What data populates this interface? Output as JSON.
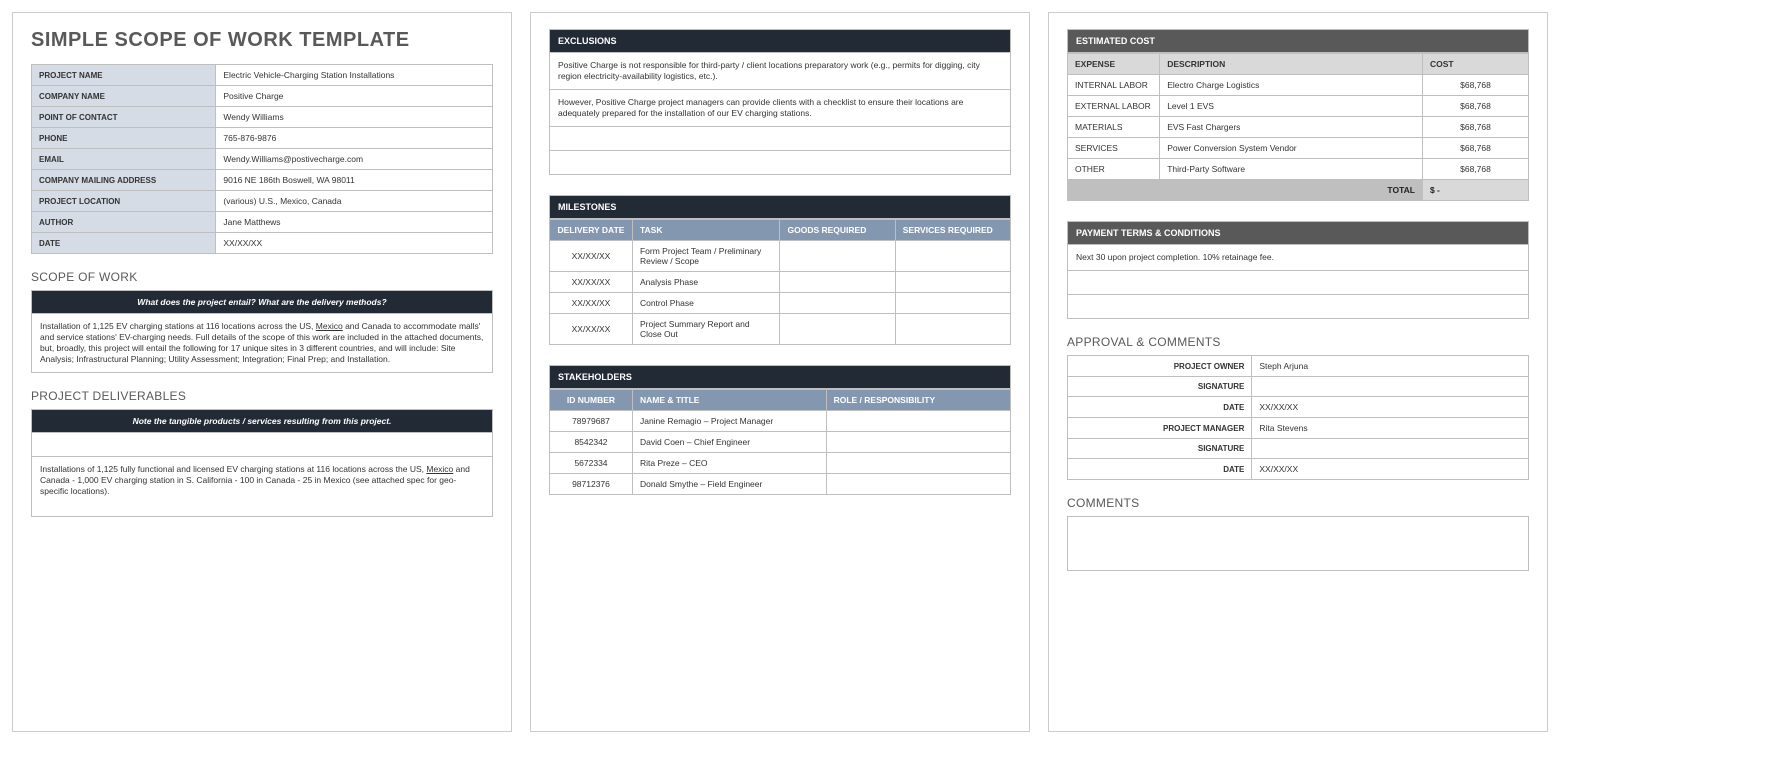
{
  "title": "SIMPLE SCOPE OF WORK TEMPLATE",
  "info": {
    "project_name_label": "PROJECT NAME",
    "project_name": "Electric Vehicle-Charging Station Installations",
    "company_name_label": "COMPANY NAME",
    "company_name": "Positive Charge",
    "poc_label": "POINT OF CONTACT",
    "poc": "Wendy Williams",
    "phone_label": "PHONE",
    "phone": "765-876-9876",
    "email_label": "EMAIL",
    "email": "Wendy.Williams@postivecharge.com",
    "addr_label": "COMPANY MAILING ADDRESS",
    "addr": "9016 NE 186th Boswell, WA 98011",
    "loc_label": "PROJECT LOCATION",
    "loc": "(various) U.S., Mexico, Canada",
    "author_label": "AUTHOR",
    "author": "Jane Matthews",
    "date_label": "DATE",
    "date": "XX/XX/XX"
  },
  "scope": {
    "heading": "SCOPE OF WORK",
    "prompt": "What does the project entail? What are the delivery methods?",
    "body_pre": "Installation of 1,125 EV charging stations at 116 locations across the US, ",
    "body_link": "Mexico",
    "body_post": " and Canada to accommodate malls' and service stations' EV-charging needs. Full details of the scope of this work are included in the attached documents, but, broadly, this project will entail the following for 17 unique sites in 3 different countries, and will include:  Site Analysis; Infrastructural Planning; Utility Assessment; Integration; Final Prep; and Installation."
  },
  "deliverables": {
    "heading": "PROJECT DELIVERABLES",
    "prompt": "Note the tangible products / services resulting from this project.",
    "body_pre": "Installations of 1,125 fully functional and licensed EV charging stations at 116 locations across the US, ",
    "body_link": "Mexico",
    "body_post": " and Canada - 1,000 EV charging station in S. California - 100 in Canada - 25 in Mexico (see attached spec for geo-specific locations)."
  },
  "exclusions": {
    "heading": "EXCLUSIONS",
    "line1": "Positive Charge is not responsible for third-party / client locations preparatory work (e.g., permits for digging, city region electricity-availability logistics, etc.).",
    "line2": "However, Positive Charge project managers can provide clients with a checklist to ensure their locations are adequately prepared for the installation of our EV charging stations."
  },
  "milestones": {
    "heading": "MILESTONES",
    "cols": {
      "date": "DELIVERY DATE",
      "task": "TASK",
      "goods": "GOODS REQUIRED",
      "services": "SERVICES REQUIRED"
    },
    "rows": [
      {
        "date": "XX/XX/XX",
        "task": "Form Project Team / Preliminary Review / Scope"
      },
      {
        "date": "XX/XX/XX",
        "task": "Analysis Phase"
      },
      {
        "date": "XX/XX/XX",
        "task": "Control Phase"
      },
      {
        "date": "XX/XX/XX",
        "task": "Project Summary Report and Close Out"
      }
    ]
  },
  "stakeholders": {
    "heading": "STAKEHOLDERS",
    "cols": {
      "id": "ID NUMBER",
      "name": "NAME & TITLE",
      "role": "ROLE / RESPONSIBILITY"
    },
    "rows": [
      {
        "id": "78979687",
        "name": "Janine Remagio – Project Manager"
      },
      {
        "id": "8542342",
        "name": "David Coen – Chief Engineer"
      },
      {
        "id": "5672334",
        "name": "Rita Preze – CEO"
      },
      {
        "id": "98712376",
        "name": "Donald Smythe – Field Engineer"
      }
    ]
  },
  "cost": {
    "heading": "ESTIMATED COST",
    "cols": {
      "expense": "EXPENSE",
      "desc": "DESCRIPTION",
      "cost": "COST"
    },
    "rows": [
      {
        "expense": "INTERNAL LABOR",
        "desc": "Electro Charge Logistics",
        "cost": "$68,768"
      },
      {
        "expense": "EXTERNAL LABOR",
        "desc": "Level 1 EVS",
        "cost": "$68,768"
      },
      {
        "expense": "MATERIALS",
        "desc": "EVS Fast Chargers",
        "cost": "$68,768"
      },
      {
        "expense": "SERVICES",
        "desc": "Power Conversion System Vendor",
        "cost": "$68,768"
      },
      {
        "expense": "OTHER",
        "desc": "Third-Party Software",
        "cost": "$68,768"
      }
    ],
    "total_label": "TOTAL",
    "total_value": " $              -"
  },
  "payment": {
    "heading": "PAYMENT TERMS & CONDITIONS",
    "line1": "Next 30 upon project completion. 10% retainage fee."
  },
  "approval": {
    "heading": "APPROVAL & COMMENTS",
    "owner_label": "PROJECT OWNER",
    "owner": "Steph Arjuna",
    "sig_label": "SIGNATURE",
    "date_label": "DATE",
    "date": "XX/XX/XX",
    "pm_label": "PROJECT MANAGER",
    "pm": "Rita Stevens"
  },
  "comments": {
    "heading": "COMMENTS"
  }
}
